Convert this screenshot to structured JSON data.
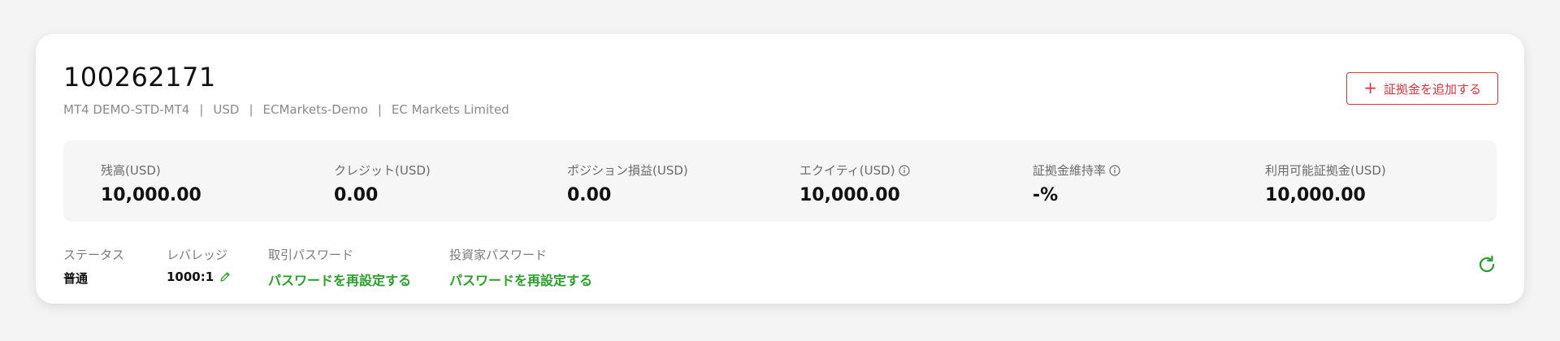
{
  "account": {
    "number": "100262171",
    "subinfo": [
      "MT4 DEMO-STD-MT4",
      "USD",
      "ECMarkets-Demo",
      "EC Markets Limited"
    ],
    "separator": "|"
  },
  "actions": {
    "add_margin_label": "証拠金を追加する",
    "add_margin_icon": "plus-icon"
  },
  "stats": [
    {
      "label": "残高(USD)",
      "value": "10,000.00",
      "info": false
    },
    {
      "label": "クレジット(USD)",
      "value": "0.00",
      "info": false
    },
    {
      "label": "ポジション損益(USD)",
      "value": "0.00",
      "info": false
    },
    {
      "label": "エクイティ(USD)",
      "value": "10,000.00",
      "info": true
    },
    {
      "label": "証拠金維持率",
      "value": "-%",
      "info": true
    },
    {
      "label": "利用可能証拠金(USD)",
      "value": "10,000.00",
      "info": false
    }
  ],
  "details": {
    "status": {
      "label": "ステータス",
      "value": "普通"
    },
    "leverage": {
      "label": "レバレッジ",
      "value": "1000:1"
    },
    "trade_password": {
      "label": "取引パスワード",
      "link": "パスワードを再設定する"
    },
    "investor_password": {
      "label": "投資家パスワード",
      "link": "パスワードを再設定する"
    }
  },
  "colors": {
    "accent_red": "#d9363e",
    "accent_green": "#2aa02a"
  }
}
